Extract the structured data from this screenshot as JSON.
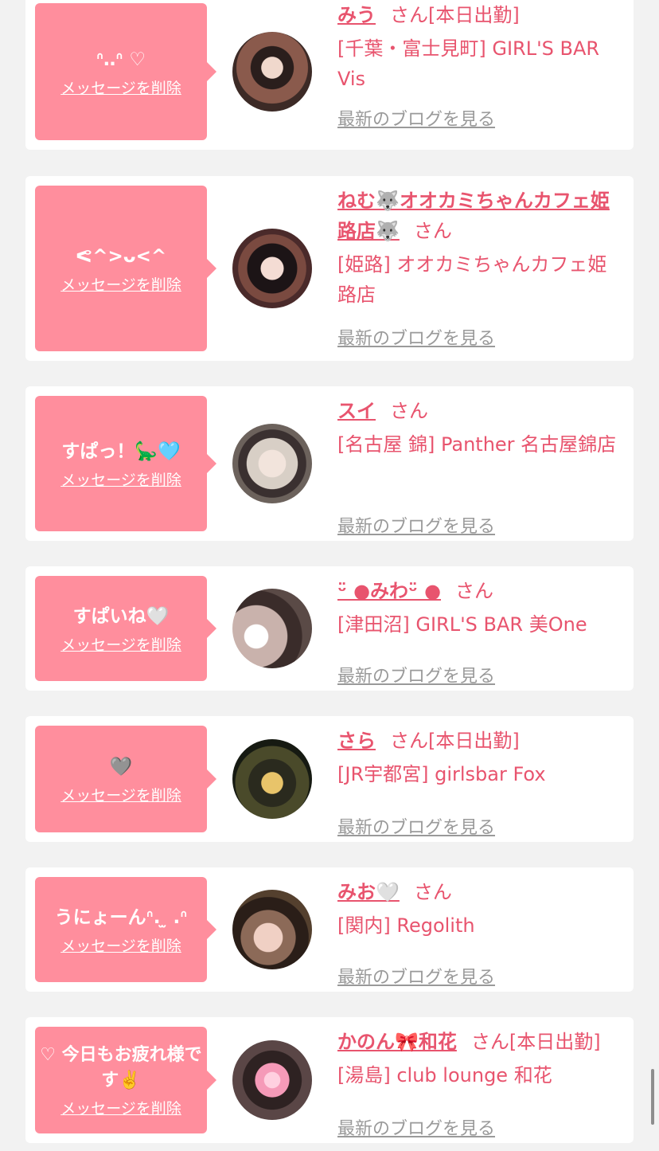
{
  "delete_label": "メッセージを削除",
  "blog_label": "最新のブログを見る",
  "san_label": "さん",
  "items": [
    {
      "message": "ᐢ‥ᐢ ♡",
      "name": "みう",
      "attendance": "[本日出勤]",
      "shop": "[千葉・富士見町] GIRL'S BAR Vis"
    },
    {
      "message": "ᕙ^>ᴗ<^",
      "name": "ねむ🐺オオカミちゃんカフェ姫路店🐺",
      "attendance": "",
      "shop": "[姫路] オオカミちゃんカフェ姫路店"
    },
    {
      "message": "すぱっ！🦕🩵",
      "name": "スイ",
      "attendance": "",
      "shop": "[名古屋 錦] Panther 名古屋錦店"
    },
    {
      "message": "すぱいね🤍",
      "name": "ᵕ̈ ●みわᵕ̈ ●",
      "attendance": "",
      "shop": "[津田沼] GIRL'S BAR 美One"
    },
    {
      "message": "🩶",
      "name": "さら",
      "attendance": "[本日出勤]",
      "shop": "[JR宇都宮] girlsbar Fox"
    },
    {
      "message": "うにょーんᐢ. ̫ .ᐢ",
      "name": "みお🤍",
      "attendance": "",
      "shop": "[関内] Regolith"
    },
    {
      "message": "♡ 今日もお疲れ様です✌️",
      "name": "かのん🎀和花",
      "attendance": "[本日出勤]",
      "shop": "[湯島] club lounge 和花"
    }
  ]
}
